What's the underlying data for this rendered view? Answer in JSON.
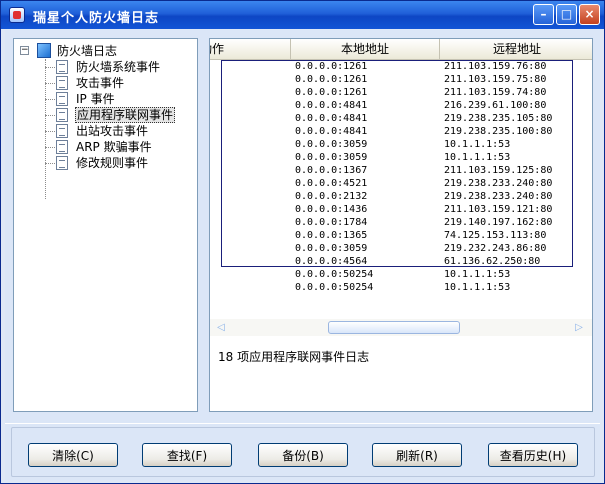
{
  "window": {
    "title": "瑞星个人防火墙日志"
  },
  "tree": {
    "root_label": "防火墙日志",
    "items": [
      {
        "label": "防火墙系统事件"
      },
      {
        "label": "攻击事件"
      },
      {
        "label": "IP 事件"
      },
      {
        "label": "应用程序联网事件",
        "selected": true
      },
      {
        "label": "出站攻击事件"
      },
      {
        "label": "ARP 欺骗事件"
      },
      {
        "label": "修改规则事件"
      }
    ]
  },
  "table": {
    "columns": [
      "动作",
      "本地地址",
      "远程地址"
    ],
    "rows": [
      {
        "local": "0.0.0.0:1261",
        "remote": "211.103.159.76:80"
      },
      {
        "local": "0.0.0.0:1261",
        "remote": "211.103.159.75:80"
      },
      {
        "local": "0.0.0.0:1261",
        "remote": "211.103.159.74:80"
      },
      {
        "local": "0.0.0.0:4841",
        "remote": "216.239.61.100:80"
      },
      {
        "local": "0.0.0.0:4841",
        "remote": "219.238.235.105:80"
      },
      {
        "local": "0.0.0.0:4841",
        "remote": "219.238.235.100:80"
      },
      {
        "local": "0.0.0.0:3059",
        "remote": "10.1.1.1:53"
      },
      {
        "local": "0.0.0.0:3059",
        "remote": "10.1.1.1:53"
      },
      {
        "local": "0.0.0.0:1367",
        "remote": "211.103.159.125:80"
      },
      {
        "local": "0.0.0.0:4521",
        "remote": "219.238.233.240:80"
      },
      {
        "local": "0.0.0.0:2132",
        "remote": "219.238.233.240:80"
      },
      {
        "local": "0.0.0.0:1436",
        "remote": "211.103.159.121:80"
      },
      {
        "local": "0.0.0.0:1784",
        "remote": "219.140.197.162:80"
      },
      {
        "local": "0.0.0.0:1365",
        "remote": "74.125.153.113:80"
      },
      {
        "local": "0.0.0.0:3059",
        "remote": "219.232.243.86:80"
      },
      {
        "local": "0.0.0.0:4564",
        "remote": "61.136.62.250:80"
      },
      {
        "local": "0.0.0.0:50254",
        "remote": "10.1.1.1:53"
      },
      {
        "local": "0.0.0.0:50254",
        "remote": "10.1.1.1:53"
      }
    ]
  },
  "summary": "18 项应用程序联网事件日志",
  "buttons": {
    "clear": "清除(C)",
    "find": "查找(F)",
    "backup": "备份(B)",
    "refresh": "刷新(R)",
    "history": "查看历史(H)"
  }
}
